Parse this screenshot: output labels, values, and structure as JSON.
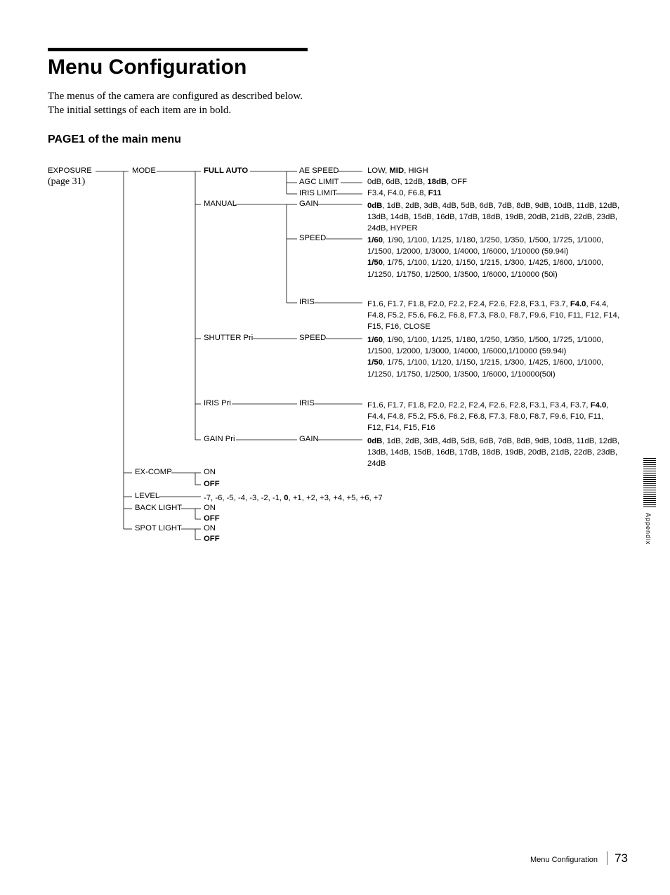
{
  "heading": "Menu Configuration",
  "intro1": "The menus of the camera are configured as described below.",
  "intro2": "The initial settings of each item are in bold.",
  "section": "PAGE1 of the main menu",
  "root": "EXPOSURE",
  "pageref": "(page 31)",
  "mode": "MODE",
  "full_auto": "FULL AUTO",
  "ae_speed": "AE SPEED",
  "ae_speed_vals_pre": "LOW, ",
  "ae_speed_vals_bold": "MID",
  "ae_speed_vals_post": ", HIGH",
  "agc_limit": "AGC LIMIT",
  "agc_vals_pre": "0dB, 6dB, 12dB, ",
  "agc_vals_bold": "18dB",
  "agc_vals_post": ", OFF",
  "iris_limit": "IRIS LIMIT",
  "iris_limit_vals_pre": "F3.4, F4.0, F6.8, ",
  "iris_limit_vals_bold": "F11",
  "manual": "MANUAL",
  "gain": "GAIN",
  "manual_gain_vals": "<b>0dB</b>, 1dB, 2dB, 3dB, 4dB, 5dB, 6dB, 7dB, 8dB, 9dB, 10dB, 11dB, 12dB, 13dB, 14dB, 15dB, 16dB, 17dB, 18dB, 19dB, 20dB, 21dB, 22dB, 23dB, 24dB, HYPER",
  "speed": "SPEED",
  "manual_speed_vals": "<b>1/60</b>, 1/90, 1/100, 1/125, 1/180, 1/250, 1/350, 1/500, 1/725, 1/1000, 1/1500, 1/2000, 1/3000, 1/4000, 1/6000, 1/10000 (59.94i)<br><b>1/50</b>, 1/75, 1/100, 1/120, 1/150, 1/215, 1/300, 1/425, 1/600, 1/1000, 1/1250, 1/1750, 1/2500, 1/3500, 1/6000, 1/10000 (50i)",
  "iris": "IRIS",
  "manual_iris_vals": "F1.6, F1.7, F1.8, F2.0, F2.2, F2.4, F2.6, F2.8, F3.1, F3.7, <b>F4.0</b>, F4.4, F4.8, F5.2, F5.6, F6.2, F6.8, F7.3, F8.0, F8.7, F9.6, F10, F11, F12, F14, F15, F16, CLOSE",
  "shutter_pri": "SHUTTER Pri",
  "shutter_speed_vals": "<b>1/60</b>, 1/90, 1/100, 1/125, 1/180, 1/250, 1/350, 1/500, 1/725, 1/1000, 1/1500, 1/2000, 1/3000, 1/4000, 1/6000,1/10000 (59.94i)<br><b>1/50</b>, 1/75, 1/100, 1/120, 1/150, 1/215, 1/300, 1/425, 1/600, 1/1000, 1/1250, 1/1750, 1/2500, 1/3500, 1/6000, 1/10000(50i)",
  "iris_pri": "IRIS Pri",
  "iris_pri_vals": "F1.6, F1.7, F1.8, F2.0, F2.2, F2.4, F2.6, F2.8, F3.1, F3.4, F3.7, <b>F4.0</b>, F4.4, F4.8, F5.2, F5.6, F6.2, F6.8, F7.3, F8.0, F8.7, F9.6, F10, F11, F12, F14, F15, F16",
  "gain_pri": "GAIN Pri",
  "gain_pri_vals": "<b>0dB</b>, 1dB, 2dB, 3dB, 4dB, 5dB, 6dB, 7dB, 8dB, 9dB, 10dB, 11dB, 12dB, 13dB, 14dB, 15dB, 16dB, 17dB, 18dB, 19dB, 20dB, 21dB, 22dB, 23dB, 24dB",
  "ex_comp": "EX-COMP",
  "on": "ON",
  "off": "OFF",
  "level": "LEVEL",
  "level_vals": "-7, -6, -5, -4, -3, -2, -1, <b>0</b>, +1, +2, +3, +4, +5, +6, +7",
  "back_light": "BACK LIGHT",
  "spot_light": "SPOT LIGHT",
  "footer_title": "Menu Configuration",
  "page_num": "73",
  "appendix": "Appendix"
}
